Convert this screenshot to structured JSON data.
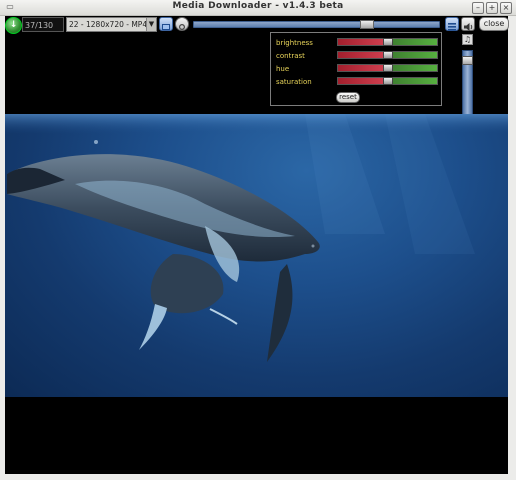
{
  "window": {
    "title": "Media Downloader - v1.4.3 beta"
  },
  "toolbar": {
    "download_icon": "download-arrow-icon",
    "counter_value": "37/130",
    "format_selected": "22 - 1280x720 - MP4",
    "progress": 0.72,
    "close_label": "close"
  },
  "adjustments": {
    "items": [
      {
        "label": "brightness",
        "value": 0.5
      },
      {
        "label": "contrast",
        "value": 0.5
      },
      {
        "label": "hue",
        "value": 0.5
      },
      {
        "label": "saturation",
        "value": 0.5
      }
    ],
    "reset_label": "reset"
  },
  "volume": {
    "level": 0.96
  },
  "colors": {
    "accent": "#5e7fae",
    "label_yellow": "#e8d45a",
    "ocean": "#1d4f8c"
  }
}
